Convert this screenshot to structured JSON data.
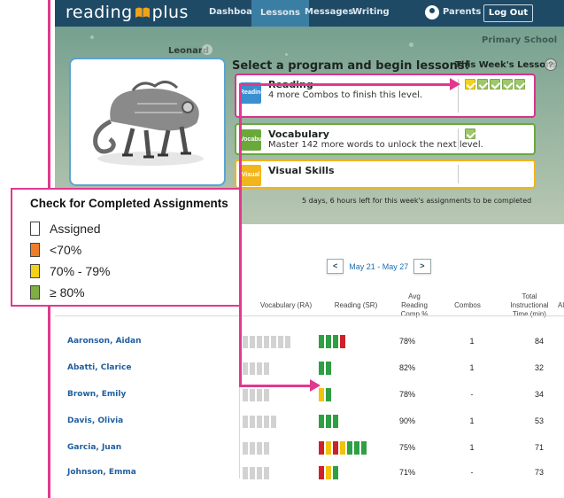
{
  "topnav": {
    "logo_left": "reading",
    "logo_right": "plus",
    "items": [
      "Dashboard",
      "Lessons",
      "Messages",
      "Writing"
    ],
    "active_item": "Lessons",
    "parents_label": "Parents",
    "logout_label": "Log Out"
  },
  "student": {
    "school": "Primary School",
    "name": "Leonard",
    "select_title": "Select a program and begin lessons!",
    "week_lessons_title": "This Week's Lessons",
    "help_glyph": "?",
    "programs": [
      {
        "name": "Reading",
        "description": "4 more Combos to finish this level.",
        "icon_label": "Reading",
        "border_color": "#d6358a",
        "icon_color": "#3a8fd0",
        "checks": 5
      },
      {
        "name": "Vocabulary",
        "description": "Master 142 more words to unlock the next level.",
        "icon_label": "Vocabulary",
        "border_color": "#6aa83c",
        "icon_color": "#6aa83c",
        "checks": 1
      },
      {
        "name": "Visual Skills",
        "description": "",
        "icon_label": "Visual",
        "border_color": "#f2b51a",
        "icon_color": "#f2b51a",
        "checks": 0
      }
    ],
    "deadline": "5 days, 6 hours left for this week's assignments to be completed"
  },
  "legend": {
    "title": "Check for Completed Assignments",
    "items": [
      {
        "label": "Assigned",
        "color": "#ffffff"
      },
      {
        "label": "<70%",
        "color": "#ee7d2a"
      },
      {
        "label": "70% - 79%",
        "color": "#f2d21a"
      },
      {
        "label": "≥ 80%",
        "color": "#7fae42"
      }
    ]
  },
  "dashboard": {
    "week_prev": "<",
    "week_range": "May 21 - May 27",
    "week_next": ">",
    "columns": {
      "vocab": "Vocabulary (RA)",
      "reading": "Reading (SR)",
      "avg": [
        "Avg",
        "Reading",
        "Comp %"
      ],
      "combos": "Combos",
      "time": [
        "Total",
        "Instructional",
        "Time (min)"
      ],
      "extra": "Al"
    },
    "colors": {
      "green": "#2ea043",
      "yellow": "#f2c20c",
      "red": "#d0202a",
      "orange": "#ee7d2a",
      "grey": "#d2d2d2"
    },
    "rows": [
      {
        "name": "Aaronson, Aidan",
        "vocab_blocks": 7,
        "reading": [
          "green",
          "green",
          "green",
          "red"
        ],
        "avg": "78%",
        "combos": "1",
        "time": "84"
      },
      {
        "name": "Abatti, Clarice",
        "vocab_blocks": 4,
        "reading": [
          "green",
          "green"
        ],
        "avg": "82%",
        "combos": "1",
        "time": "32"
      },
      {
        "name": "Brown, Emily",
        "vocab_blocks": 4,
        "reading": [
          "yellow",
          "green"
        ],
        "avg": "78%",
        "combos": "-",
        "time": "34"
      },
      {
        "name": "Davis, Olivia",
        "vocab_blocks": 5,
        "reading": [
          "green",
          "green",
          "green"
        ],
        "avg": "90%",
        "combos": "1",
        "time": "53"
      },
      {
        "name": "Garcia, Juan",
        "vocab_blocks": 4,
        "reading": [
          "red",
          "yellow",
          "red",
          "yellow",
          "green",
          "green",
          "green"
        ],
        "avg": "75%",
        "combos": "1",
        "time": "71"
      },
      {
        "name": "Johnson, Emma",
        "vocab_blocks": 4,
        "reading": [
          "red",
          "yellow",
          "green"
        ],
        "avg": "71%",
        "combos": "-",
        "time": "73"
      }
    ]
  }
}
